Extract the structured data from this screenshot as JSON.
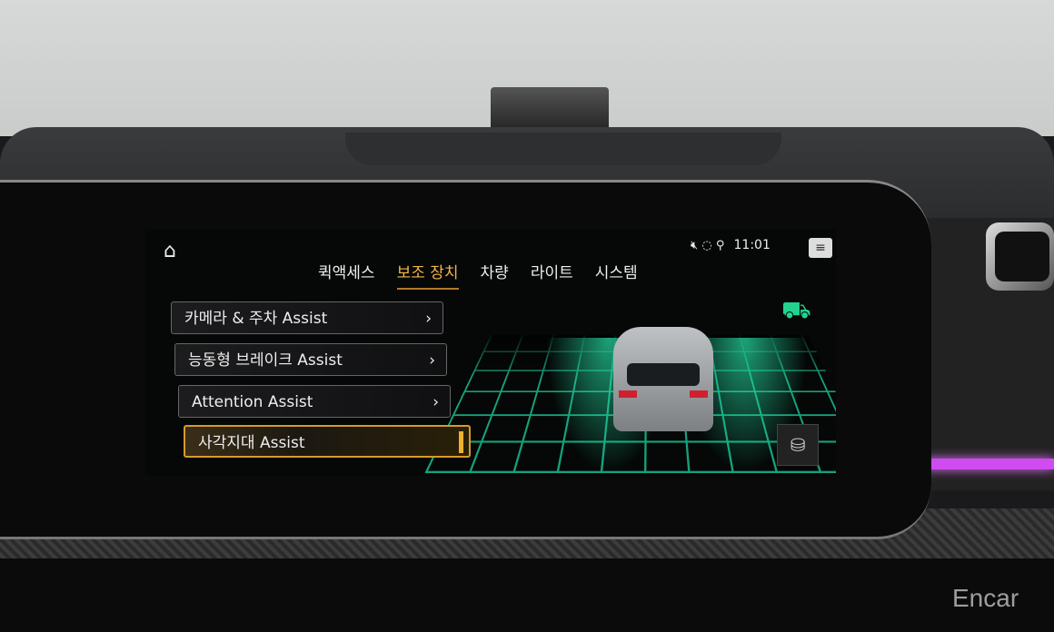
{
  "status": {
    "time": "11:01",
    "icons": [
      "mute-icon",
      "gps-icon",
      "seat-icon"
    ]
  },
  "tabs": [
    {
      "label": "퀵액세스",
      "active": false
    },
    {
      "label": "보조 장치",
      "active": true
    },
    {
      "label": "차량",
      "active": false
    },
    {
      "label": "라이트",
      "active": false
    },
    {
      "label": "시스템",
      "active": false
    }
  ],
  "menu": [
    {
      "label": "카메라 & 주차 Assist",
      "chevron": "›"
    },
    {
      "label": "능동형 브레이크 Assist",
      "chevron": "›"
    },
    {
      "label": "Attention Assist",
      "chevron": "›"
    },
    {
      "label": "사각지대 Assist",
      "selected": true
    }
  ],
  "watermark": "Encar",
  "colors": {
    "accent": "#f3b54a",
    "grid": "#19c79a",
    "ambient": "#d04bf0"
  }
}
